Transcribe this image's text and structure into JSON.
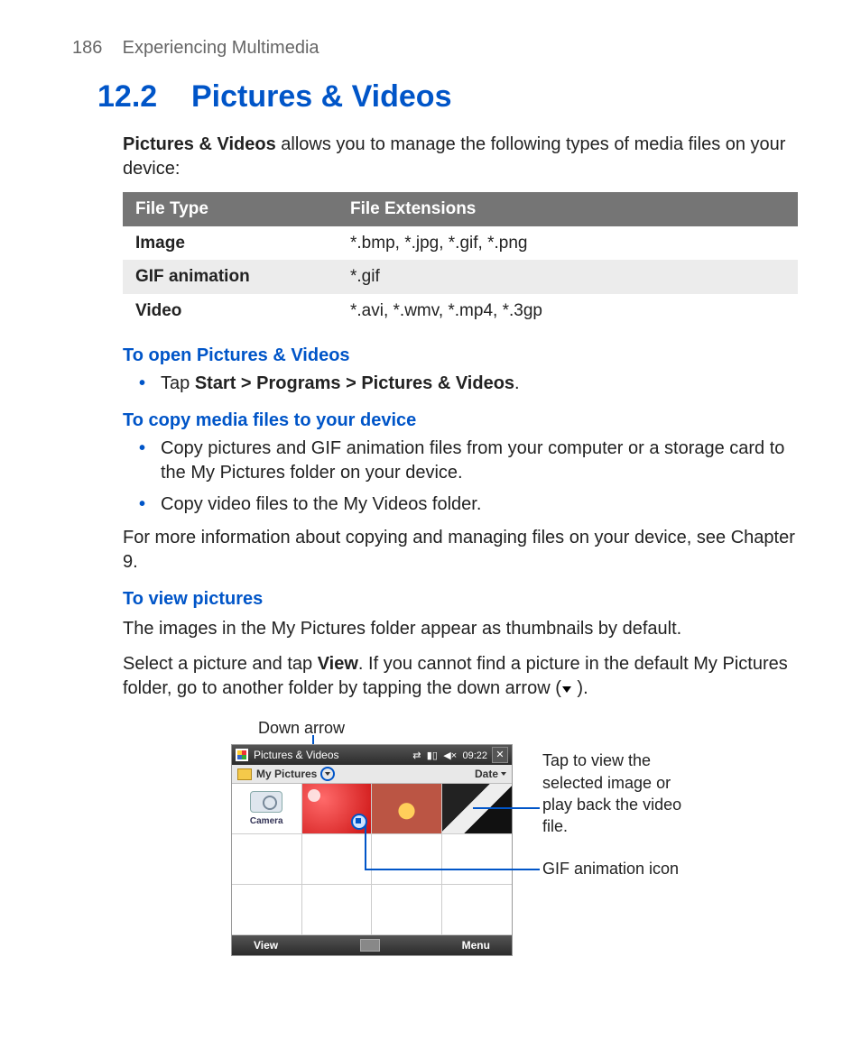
{
  "page": {
    "number": "186",
    "chapter": "Experiencing Multimedia"
  },
  "section": {
    "number": "12.2",
    "title": "Pictures & Videos"
  },
  "intro": {
    "strong": "Pictures & Videos",
    "rest": " allows you to manage the following types of media files on your device:"
  },
  "table": {
    "headers": {
      "col1": "File Type",
      "col2": "File Extensions"
    },
    "rows": [
      {
        "type": "Image",
        "ext": "*.bmp, *.jpg, *.gif, *.png"
      },
      {
        "type": "GIF animation",
        "ext": "*.gif"
      },
      {
        "type": "Video",
        "ext": "*.avi, *.wmv, *.mp4, *.3gp"
      }
    ]
  },
  "sec_open": {
    "head": "To open Pictures & Videos",
    "bullet_pre": "Tap ",
    "bullet_bold": "Start > Programs > Pictures & Videos",
    "bullet_post": "."
  },
  "sec_copy": {
    "head": "To copy media files to your device",
    "b1": "Copy pictures and GIF animation files from your computer or a storage card to the My Pictures folder on your device.",
    "b2": "Copy video files to the My Videos folder.",
    "tail": "For more information about copying and managing files on your device, see Chapter 9."
  },
  "sec_view": {
    "head": "To view pictures",
    "p1": "The images in the My Pictures folder appear as thumbnails by default.",
    "p2_a": "Select a picture and tap ",
    "p2_bold": "View",
    "p2_b": ". If you cannot find a picture in the default My Pictures folder, go to another folder by tapping the down arrow (",
    "p2_c": "    )."
  },
  "figure": {
    "label_down": "Down arrow",
    "note1": "Tap to view the selected image or play back the video file.",
    "note2": "GIF animation icon",
    "device": {
      "title": "Pictures & Videos",
      "time": "09:22",
      "folder": "My Pictures",
      "sort": "Date",
      "camera": "Camera",
      "soft_left": "View",
      "soft_right": "Menu"
    }
  }
}
